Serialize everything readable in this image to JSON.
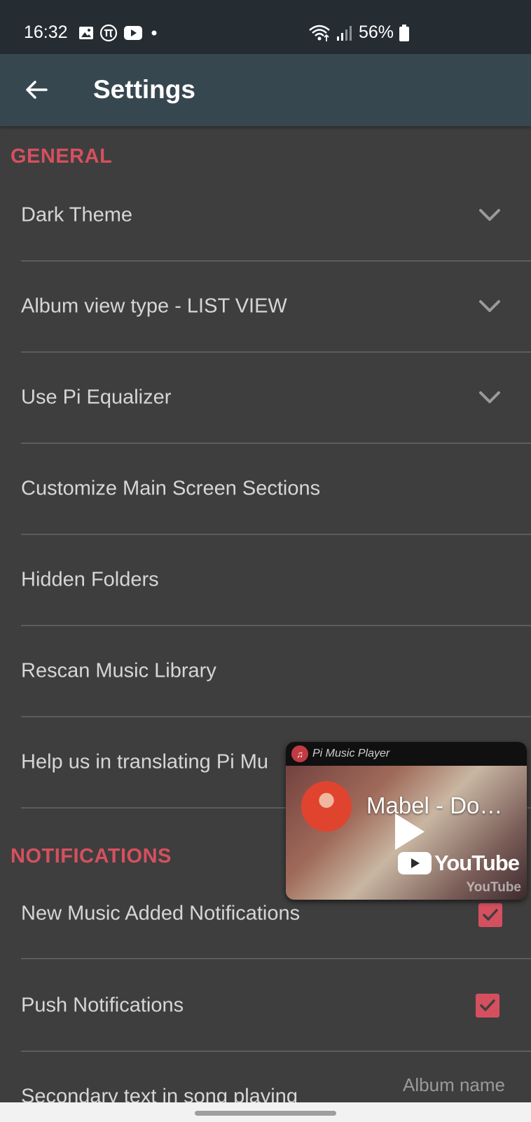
{
  "status_bar": {
    "time": "16:32",
    "battery": "56%",
    "icons": [
      "gallery-icon",
      "pi-icon",
      "youtube-icon",
      "dot-icon",
      "wifi-icon",
      "signal-icon",
      "battery-icon"
    ]
  },
  "app_bar": {
    "title": "Settings",
    "back_icon": "arrow-left-icon"
  },
  "sections": {
    "general": "GENERAL",
    "notifications": "NOTIFICATIONS"
  },
  "general_items": [
    {
      "label": "Dark Theme",
      "control": "chevron-down"
    },
    {
      "label": "Album view type - LIST VIEW",
      "control": "chevron-down"
    },
    {
      "label": "Use Pi Equalizer",
      "control": "chevron-down"
    },
    {
      "label": "Customize Main Screen Sections"
    },
    {
      "label": "Hidden Folders"
    },
    {
      "label": "Rescan Music Library"
    },
    {
      "label": "Help us in translating Pi Mu"
    }
  ],
  "notification_items": [
    {
      "label": "New Music Added Notifications",
      "checked": true
    },
    {
      "label": "Push Notifications",
      "checked": true
    },
    {
      "label": "Secondary text in song playing",
      "value": "Album name"
    }
  ],
  "pip_player": {
    "app_name": "Pi Music Player",
    "video_title": "Mabel - Do…",
    "brand": "YouTube",
    "watermark": "YouTube"
  },
  "colors": {
    "accent": "#d5505f",
    "app_bar": "#37474f",
    "status_bar": "#252d33",
    "background": "#3e3e3e"
  }
}
